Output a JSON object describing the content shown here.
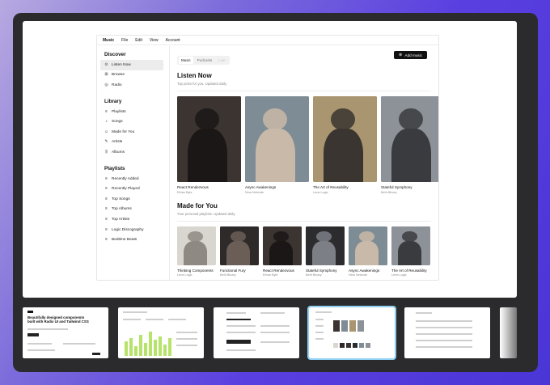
{
  "menu": [
    "Music",
    "File",
    "Edit",
    "View",
    "Account"
  ],
  "sidebar": {
    "discover_title": "Discover",
    "discover": [
      {
        "label": "Listen Now",
        "icon": "play-circle-icon",
        "active": true
      },
      {
        "label": "Browse",
        "icon": "grid-icon"
      },
      {
        "label": "Radio",
        "icon": "radio-icon"
      }
    ],
    "library_title": "Library",
    "library": [
      {
        "label": "Playlists",
        "icon": "playlist-icon"
      },
      {
        "label": "Songs",
        "icon": "music-note-icon"
      },
      {
        "label": "Made for You",
        "icon": "user-icon"
      },
      {
        "label": "Artists",
        "icon": "microphone-icon"
      },
      {
        "label": "Albums",
        "icon": "library-icon"
      }
    ],
    "playlists_title": "Playlists",
    "playlists": [
      {
        "label": "Recently Added",
        "icon": "playlist-icon"
      },
      {
        "label": "Recently Played",
        "icon": "playlist-icon"
      },
      {
        "label": "Top Songs",
        "icon": "playlist-icon"
      },
      {
        "label": "Top Albums",
        "icon": "playlist-icon"
      },
      {
        "label": "Top Artists",
        "icon": "playlist-icon"
      },
      {
        "label": "Logic Discography",
        "icon": "playlist-icon"
      },
      {
        "label": "Bedtime Beats",
        "icon": "playlist-icon"
      }
    ]
  },
  "tabs": [
    {
      "label": "Music",
      "state": "on"
    },
    {
      "label": "Podcasts",
      "state": "off"
    },
    {
      "label": "Live",
      "state": "dim"
    }
  ],
  "add_music": "Add music",
  "listen_now": {
    "title": "Listen Now",
    "subtitle": "Top picks for you. Updated daily.",
    "albums": [
      {
        "title": "React Rendezvous",
        "artist": "Ethan Byte",
        "bg": "#3b3430",
        "fg": "#1a1716"
      },
      {
        "title": "Async Awakenings",
        "artist": "Nina Netcode",
        "bg": "#7e8c95",
        "fg": "#c9b9a8"
      },
      {
        "title": "The Art of Reusability",
        "artist": "Lena Logic",
        "bg": "#a9956f",
        "fg": "#3a3530"
      },
      {
        "title": "Stateful Symphony",
        "artist": "Beth Binary",
        "bg": "#8d9198",
        "fg": "#3a3b3e"
      }
    ]
  },
  "made_for_you": {
    "title": "Made for You",
    "subtitle": "Your personal playlists. Updated daily.",
    "playlists": [
      {
        "title": "Thinking Components",
        "artist": "Lena Logic",
        "bg": "#d9d6cf",
        "fg": "#8e8a83"
      },
      {
        "title": "Functional Fury",
        "artist": "Beth Binary",
        "bg": "#2e2a29",
        "fg": "#6a5e57"
      },
      {
        "title": "React Rendezvous",
        "artist": "Ethan Byte",
        "bg": "#3b3430",
        "fg": "#1a1716"
      },
      {
        "title": "Stateful Symphony",
        "artist": "Beth Binary",
        "bg": "#2c2c2e",
        "fg": "#7c7f86"
      },
      {
        "title": "Async Awakenings",
        "artist": "Nina Netcode",
        "bg": "#7e8c95",
        "fg": "#c9b9a8"
      },
      {
        "title": "The Art of Reusability",
        "artist": "Lena Logic",
        "bg": "#8d9198",
        "fg": "#3a3b3e"
      }
    ]
  },
  "thumbnails": [
    {
      "caption": "Beautifully designed components built with Radix UI and Tailwind CSS",
      "selected": false
    },
    {
      "caption": "",
      "selected": false
    },
    {
      "caption": "",
      "selected": false
    },
    {
      "caption": "",
      "selected": true
    },
    {
      "caption": "",
      "selected": false
    }
  ]
}
